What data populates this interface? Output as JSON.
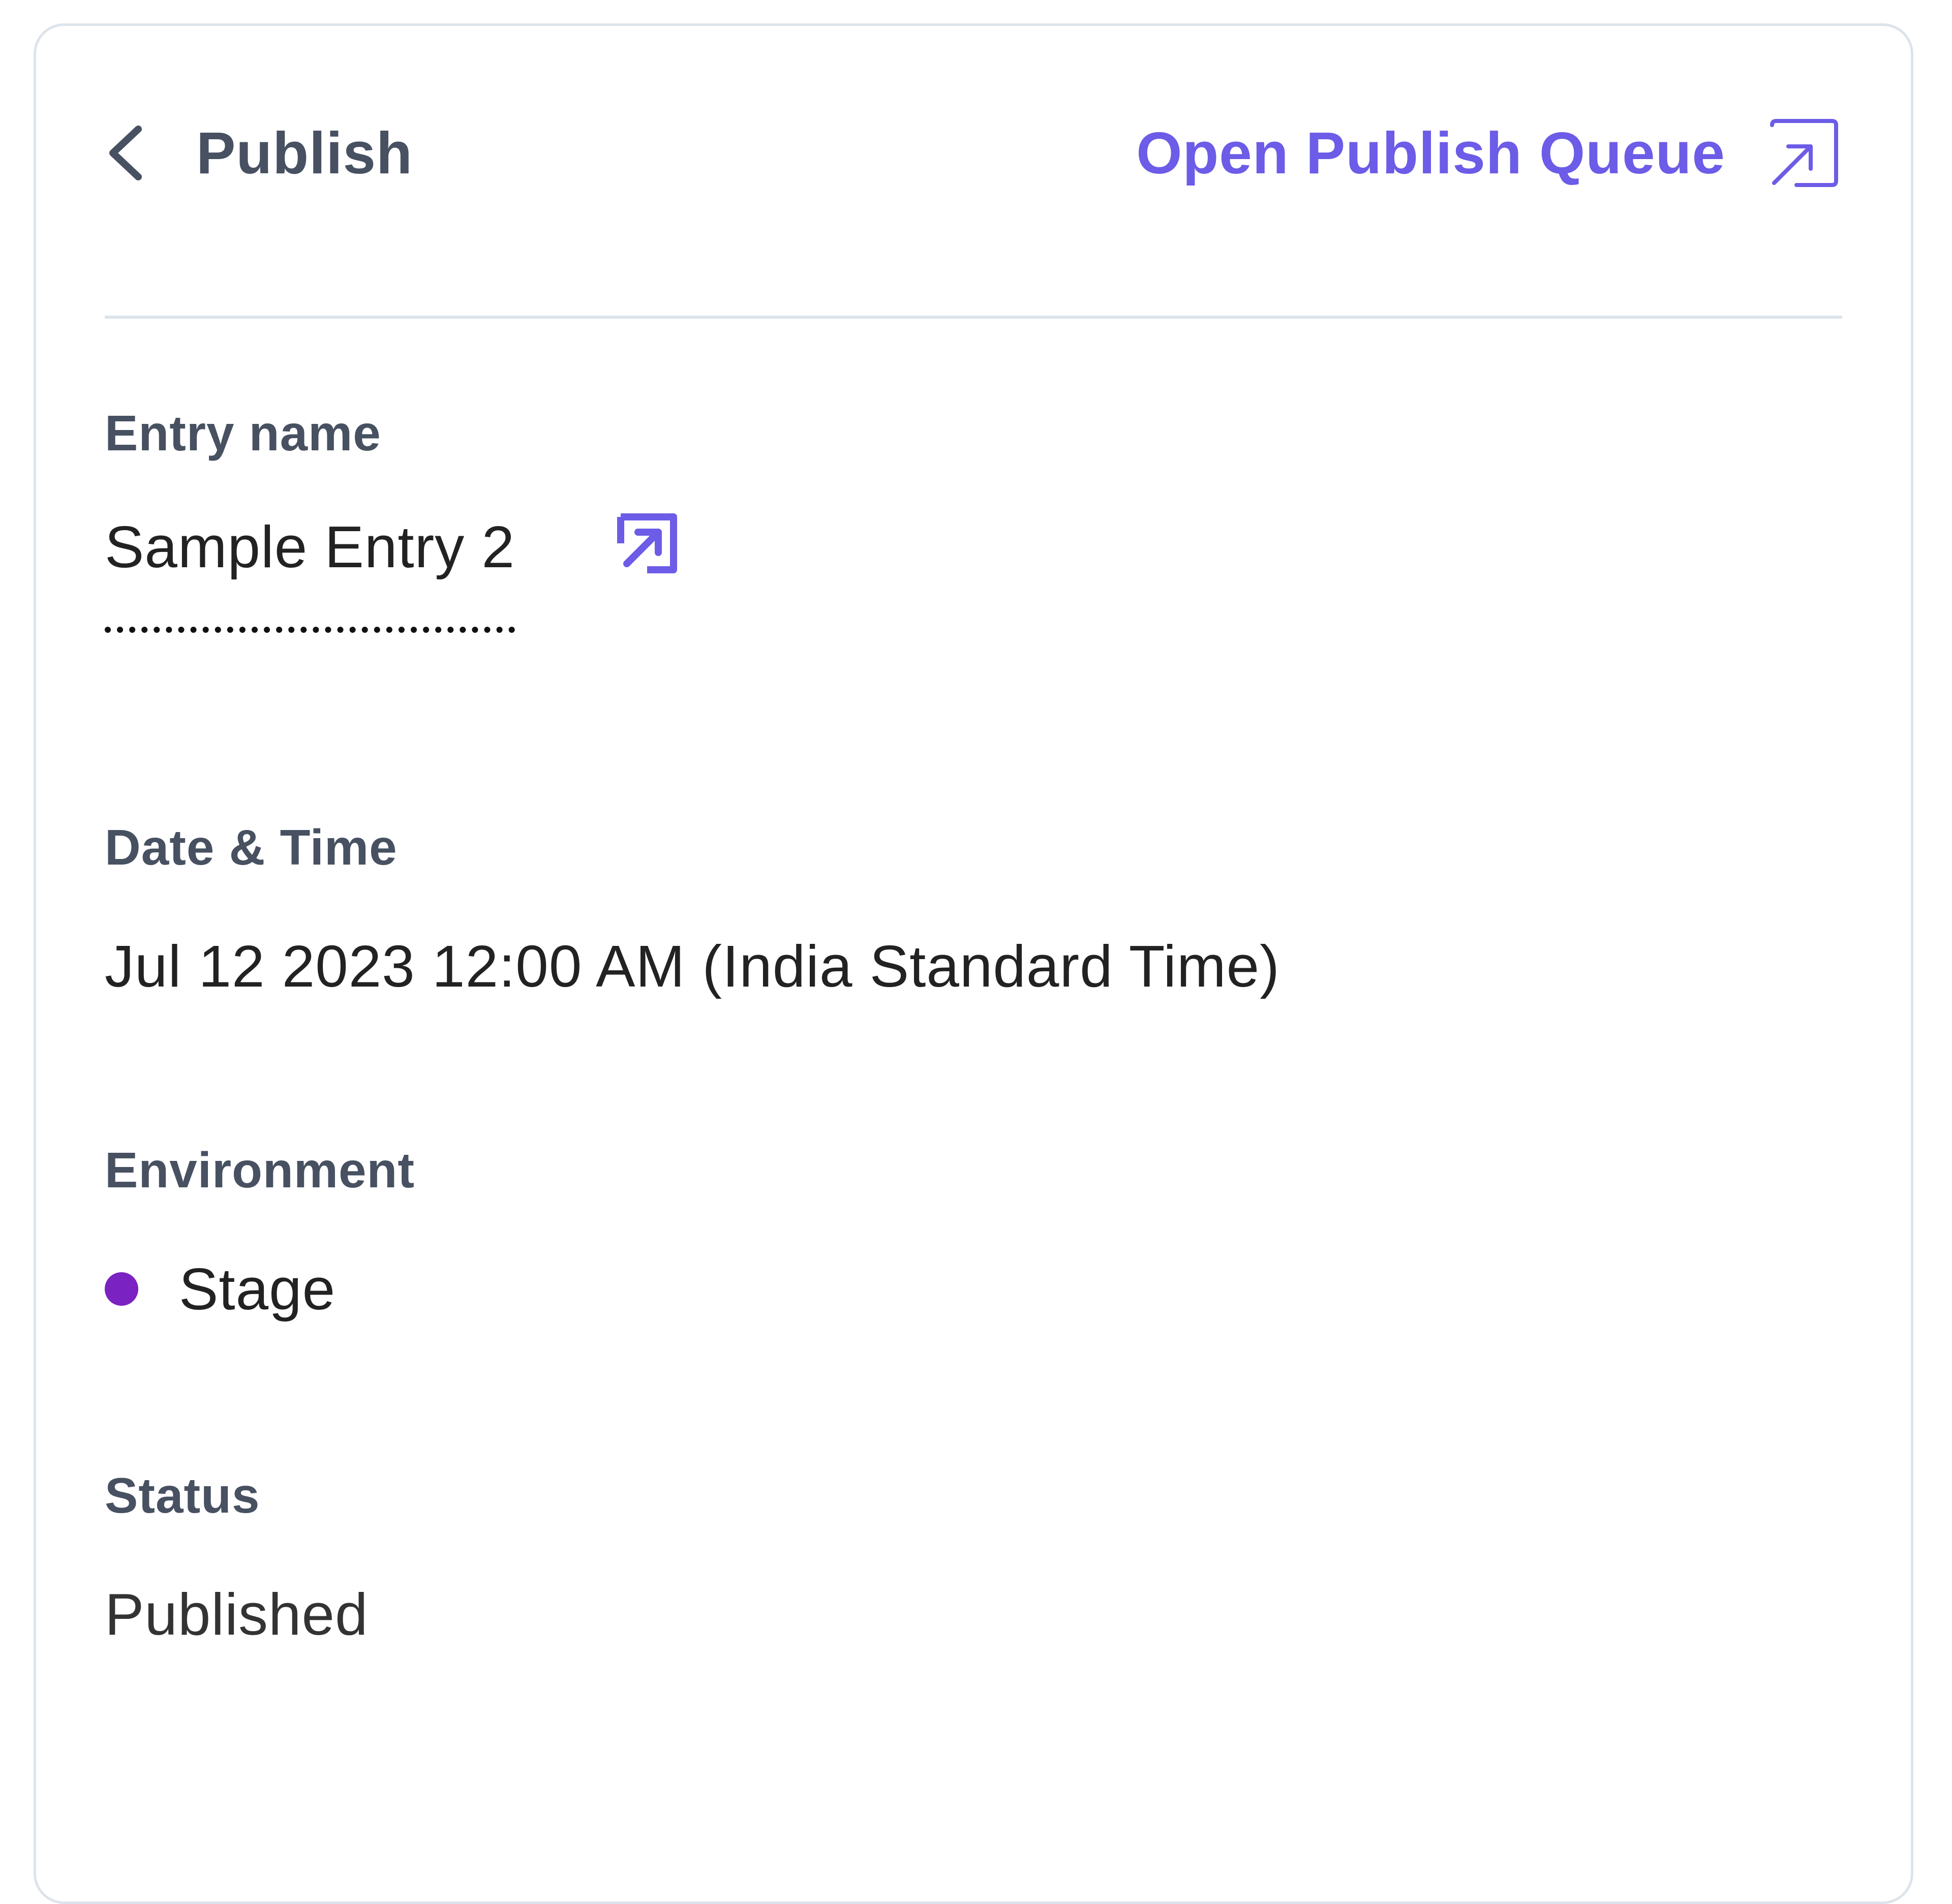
{
  "header": {
    "title": "Publish",
    "queue_link_label": "Open Publish Queue"
  },
  "fields": {
    "entry": {
      "label": "Entry name",
      "value": "Sample Entry 2"
    },
    "datetime": {
      "label": "Date & Time",
      "value": "Jul 12 2023 12:00 AM (India Standard Time)"
    },
    "environment": {
      "label": "Environment",
      "value": "Stage",
      "dot_color": "#7b22c2"
    },
    "status": {
      "label": "Status",
      "value": "Published"
    }
  },
  "colors": {
    "accent": "#6c5ce7",
    "heading": "#475161",
    "border": "#dde3ea"
  },
  "icons": {
    "back": "chevron-left-icon",
    "queue": "external-link-icon",
    "entry_open": "external-link-icon"
  }
}
